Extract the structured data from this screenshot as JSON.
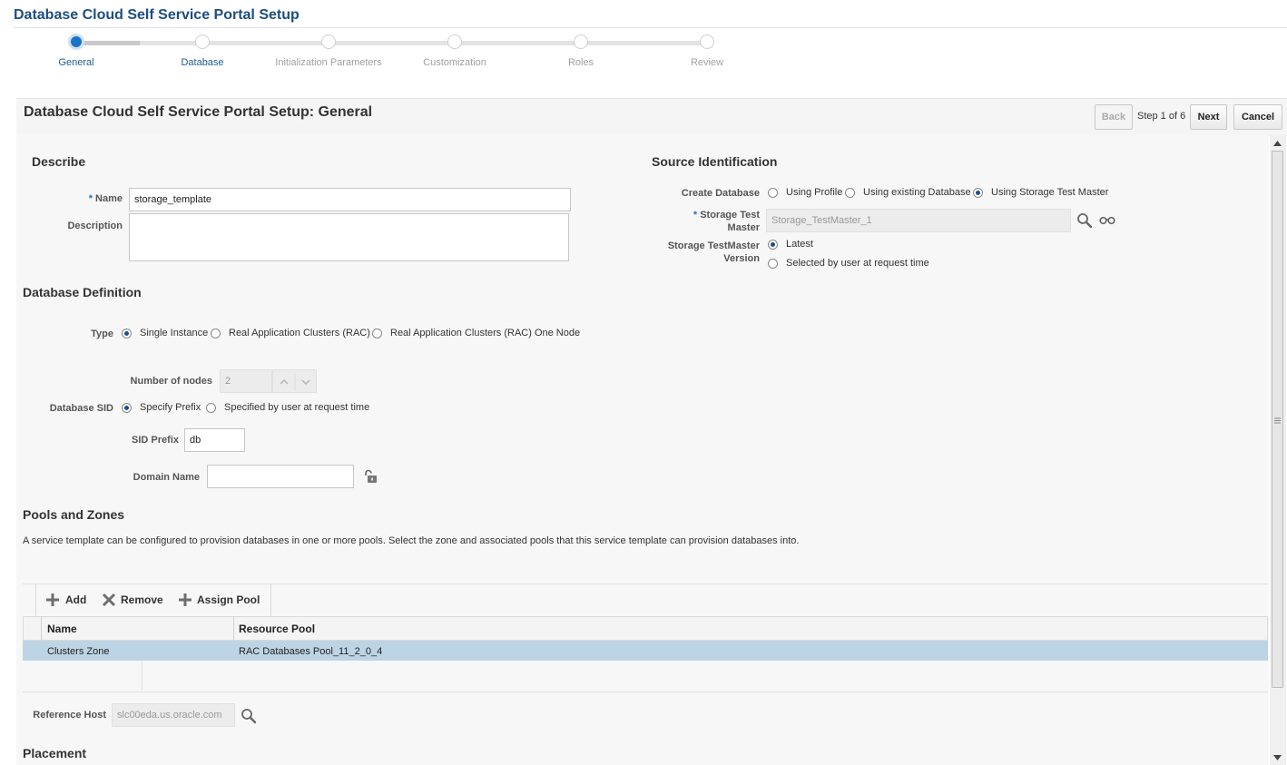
{
  "app_title": "Database Cloud Self Service Portal Setup",
  "train": {
    "steps": [
      "General",
      "Database",
      "Initialization Parameters",
      "Customization",
      "Roles",
      "Review"
    ],
    "current": 0
  },
  "page": {
    "title": "Database Cloud Self Service Portal Setup: General",
    "back_label": "Back",
    "step_text": "Step 1 of 6",
    "next_label": "Next",
    "cancel_label": "Cancel"
  },
  "describe": {
    "heading": "Describe",
    "name_label": "Name",
    "name_value": "storage_template",
    "description_label": "Description",
    "description_value": ""
  },
  "source": {
    "heading": "Source Identification",
    "create_db_label": "Create Database",
    "options": [
      "Using Profile",
      "Using existing Database",
      "Using Storage Test Master"
    ],
    "selected": "Using Storage Test Master",
    "test_master_label_1": "Storage Test",
    "test_master_label_2": "Master",
    "test_master_value": "Storage_TestMaster_1",
    "version_label_1": "Storage TestMaster",
    "version_label_2": "Version",
    "version_options": [
      "Latest",
      "Selected by user at request time"
    ],
    "version_selected": "Latest"
  },
  "db_def": {
    "heading": "Database Definition",
    "type_label": "Type",
    "type_options": [
      "Single Instance",
      "Real Application Clusters (RAC)",
      "Real Application Clusters (RAC) One Node"
    ],
    "type_selected": "Single Instance",
    "nodes_label": "Number of nodes",
    "nodes_value": "2",
    "sid_label": "Database SID",
    "sid_options": [
      "Specify Prefix",
      "Specified by user at request time"
    ],
    "sid_selected": "Specify Prefix",
    "sid_prefix_label": "SID Prefix",
    "sid_prefix_value": "db",
    "domain_label": "Domain Name",
    "domain_value": ""
  },
  "pools": {
    "heading": "Pools and Zones",
    "description": "A service template can be configured to provision databases in one or more pools. Select the zone and associated pools that this service template can provision databases into.",
    "toolbar": {
      "add": "Add",
      "remove": "Remove",
      "assign": "Assign Pool"
    },
    "columns": [
      "Name",
      "Resource Pool"
    ],
    "rows": [
      {
        "name": "Clusters Zone",
        "pool": "RAC Databases Pool_11_2_0_4"
      }
    ]
  },
  "reference_host": {
    "label": "Reference Host",
    "value": "slc00eda.us.oracle.com"
  },
  "placement": {
    "heading": "Placement"
  },
  "colors": {
    "brand": "#1c4e80",
    "accent": "#1a73c9",
    "selected_row": "#bdd4e5"
  }
}
